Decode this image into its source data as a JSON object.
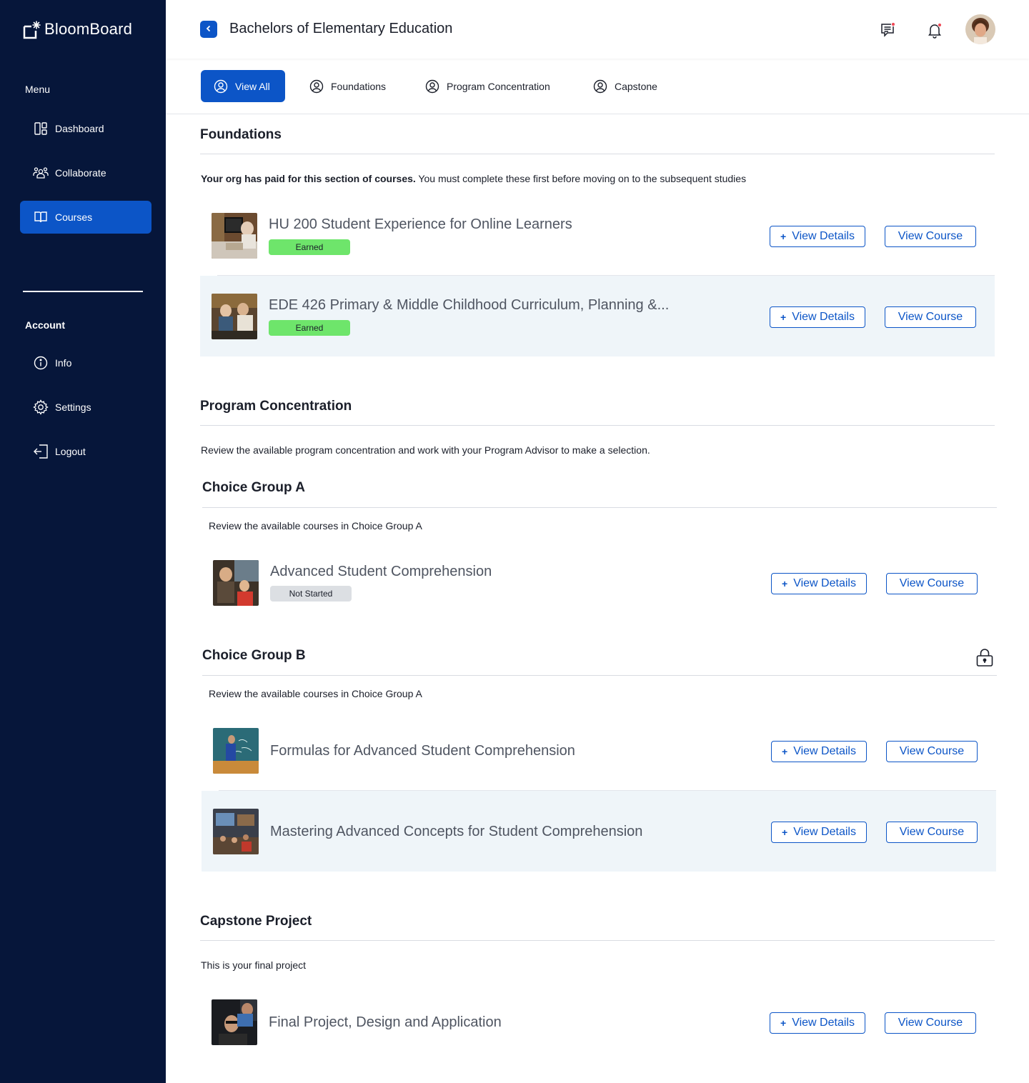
{
  "sidebar": {
    "logo_text": "BloomBoard",
    "menu_label": "Menu",
    "menu_items": [
      {
        "label": "Dashboard",
        "icon": "dashboard-icon"
      },
      {
        "label": "Collaborate",
        "icon": "collaborate-icon"
      },
      {
        "label": "Courses",
        "icon": "book-icon",
        "active": true
      }
    ],
    "account_label": "Account",
    "account_items": [
      {
        "label": "Info",
        "icon": "info-icon"
      },
      {
        "label": "Settings",
        "icon": "gear-icon"
      },
      {
        "label": "Logout",
        "icon": "logout-icon"
      }
    ]
  },
  "header": {
    "title": "Bachelors of Elementary Education",
    "icons": [
      "chat-icon",
      "bell-icon",
      "avatar"
    ]
  },
  "tabs": [
    {
      "label": "View All",
      "active": true
    },
    {
      "label": "Foundations"
    },
    {
      "label": "Program Concentration"
    },
    {
      "label": "Capstone"
    }
  ],
  "foundations": {
    "title": "Foundations",
    "desc_bold": "Your org has paid for this section of courses.",
    "desc_rest": " You must complete these first before moving on to the subsequent studies",
    "courses": [
      {
        "name": "HU 200 Student Experience for Online Learners",
        "status": "Earned"
      },
      {
        "name": "EDE 426 Primary & Middle Childhood Curriculum,  Planning &...",
        "status": "Earned"
      }
    ]
  },
  "program": {
    "title": "Program Concentration",
    "desc": "Review the available program concentration and work with your Program Advisor to make a selection.",
    "group_a": {
      "title": "Choice Group A",
      "desc": "Review the available courses in Choice Group A",
      "courses": [
        {
          "name": "Advanced Student Comprehension",
          "status": "Not Started"
        }
      ]
    },
    "group_b": {
      "title": "Choice Group B",
      "desc": "Review the available courses in Choice Group A",
      "courses": [
        {
          "name": "Formulas for Advanced Student Comprehension"
        },
        {
          "name": "Mastering Advanced Concepts for Student Comprehension"
        }
      ]
    }
  },
  "capstone": {
    "title": "Capstone Project",
    "desc": "This is your final project",
    "courses": [
      {
        "name": "Final Project, Design and Application"
      }
    ]
  },
  "buttons": {
    "details_plus": "+",
    "details": "View Details",
    "course": "View Course"
  },
  "colors": {
    "sidebar_bg": "#06163a",
    "accent": "#0c55c7",
    "earned": "#6ee56b",
    "not_started": "#dcdfe3",
    "row_alt": "#eff5f9"
  }
}
